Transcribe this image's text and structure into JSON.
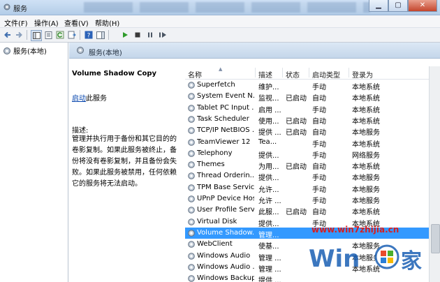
{
  "window": {
    "title": "服务"
  },
  "menu": [
    "文件(F)",
    "操作(A)",
    "查看(V)",
    "帮助(H)"
  ],
  "tree": {
    "root_label": "服务(本地)"
  },
  "pane": {
    "header_title": "服务(本地)"
  },
  "description": {
    "service_name": "Volume Shadow Copy",
    "start_link": "启动",
    "start_suffix": "此服务",
    "label": "描述:",
    "text": "管理并执行用于备份和其它目的的卷影复制。如果此服务被终止，备份将没有卷影复制，并且备份会失败。如果此服务被禁用，任何依赖它的服务将无法启动。"
  },
  "columns": {
    "name": "名称",
    "desc": "描述",
    "status": "状态",
    "startup": "启动类型",
    "logon": "登录为"
  },
  "services": [
    {
      "name": "Superfetch",
      "desc": "维护...",
      "status": "",
      "startup": "手动",
      "logon": "本地系统"
    },
    {
      "name": "System Event N...",
      "desc": "监视...",
      "status": "已启动",
      "startup": "自动",
      "logon": "本地系统"
    },
    {
      "name": "Tablet PC Input ...",
      "desc": "启用 ...",
      "status": "",
      "startup": "手动",
      "logon": "本地系统"
    },
    {
      "name": "Task Scheduler",
      "desc": "使用...",
      "status": "已启动",
      "startup": "自动",
      "logon": "本地系统"
    },
    {
      "name": "TCP/IP NetBIOS ...",
      "desc": "提供 ...",
      "status": "已启动",
      "startup": "自动",
      "logon": "本地服务"
    },
    {
      "name": "TeamViewer 12",
      "desc": "Tea...",
      "status": "",
      "startup": "手动",
      "logon": "本地系统"
    },
    {
      "name": "Telephony",
      "desc": "提供...",
      "status": "",
      "startup": "手动",
      "logon": "网络服务"
    },
    {
      "name": "Themes",
      "desc": "为用...",
      "status": "已启动",
      "startup": "自动",
      "logon": "本地系统"
    },
    {
      "name": "Thread Orderin...",
      "desc": "提供...",
      "status": "",
      "startup": "手动",
      "logon": "本地服务"
    },
    {
      "name": "TPM Base Servic...",
      "desc": "允许...",
      "status": "",
      "startup": "手动",
      "logon": "本地服务"
    },
    {
      "name": "UPnP Device Host",
      "desc": "允许 ...",
      "status": "",
      "startup": "手动",
      "logon": "本地服务"
    },
    {
      "name": "User Profile Serv...",
      "desc": "此服...",
      "status": "已启动",
      "startup": "自动",
      "logon": "本地系统"
    },
    {
      "name": "Virtual Disk",
      "desc": "提供...",
      "status": "",
      "startup": "手动",
      "logon": "本地系统"
    },
    {
      "name": "Volume Shadow...",
      "desc": "管理...",
      "status": "",
      "startup": "",
      "logon": "",
      "selected": true
    },
    {
      "name": "WebClient",
      "desc": "使基...",
      "status": "",
      "startup": "",
      "logon": "本地服务"
    },
    {
      "name": "Windows Audio",
      "desc": "管理 ...",
      "status": "",
      "startup": "",
      "logon": "本地服务"
    },
    {
      "name": "Windows Audio ...",
      "desc": "管理 ...",
      "status": "",
      "startup": "",
      "logon": "本地系统"
    },
    {
      "name": "Windows Backup",
      "desc": "提供 ...",
      "status": "",
      "startup": "",
      "logon": ""
    }
  ],
  "watermark": {
    "url": "www.win7zhijia.cn",
    "logo_text": "Win7家"
  },
  "colors": {
    "selection": "#3399ff",
    "header_gradient": "#c4d6ea",
    "watermark_red": "#d81e1e",
    "watermark_blue": "#1a5fb4"
  }
}
